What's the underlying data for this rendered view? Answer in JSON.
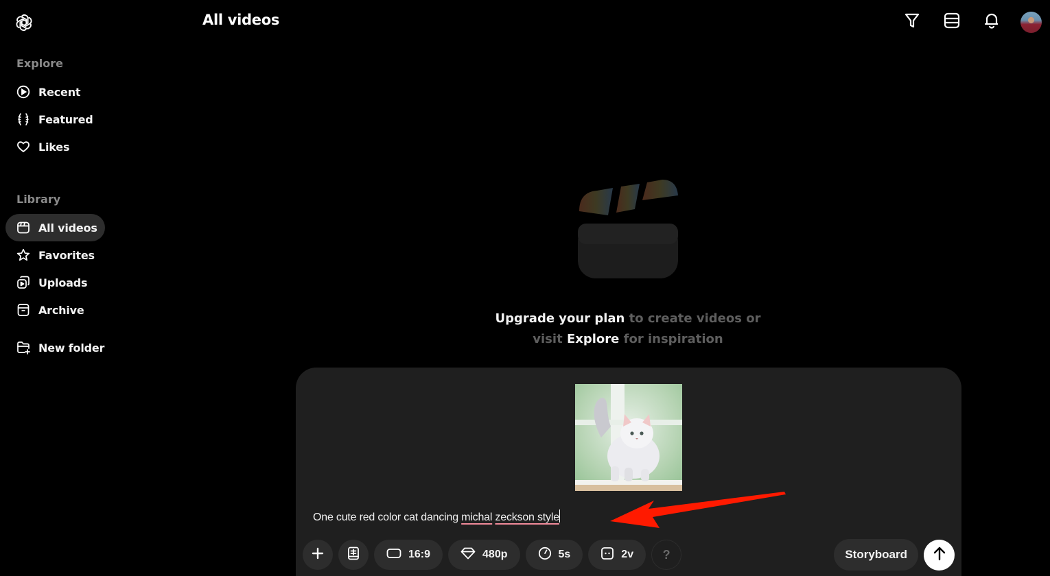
{
  "header": {
    "title": "All videos",
    "logo_icon": "openai-logo-icon",
    "actions": [
      {
        "name": "filter",
        "icon": "filter-icon"
      },
      {
        "name": "layout",
        "icon": "list-layout-icon"
      },
      {
        "name": "notifications",
        "icon": "bell-icon"
      },
      {
        "name": "profile",
        "icon": "avatar"
      }
    ]
  },
  "sidebar": {
    "explore_label": "Explore",
    "explore_items": [
      {
        "label": "Recent",
        "icon": "play-circle-icon"
      },
      {
        "label": "Featured",
        "icon": "laurel-icon"
      },
      {
        "label": "Likes",
        "icon": "heart-icon"
      }
    ],
    "library_label": "Library",
    "library_items": [
      {
        "label": "All videos",
        "icon": "clapperboard-icon",
        "active": true
      },
      {
        "label": "Favorites",
        "icon": "star-icon"
      },
      {
        "label": "Uploads",
        "icon": "uploads-icon"
      },
      {
        "label": "Archive",
        "icon": "archive-icon"
      }
    ],
    "new_folder_label": "New folder"
  },
  "empty_state": {
    "highlight_1": "Upgrade your plan",
    "text_1": " to create videos or",
    "text_2": "visit ",
    "highlight_2": "Explore",
    "text_3": " for inspiration"
  },
  "composer": {
    "attached_image": "cat-photo",
    "prompt_parts": {
      "plain": "One cute red color cat dancing ",
      "misspelled_1": "michal",
      "space": " ",
      "misspelled_2": "zeckson style"
    },
    "toolbar": {
      "add_icon": "plus-icon",
      "preset_icon": "preset-book-icon",
      "aspect_ratio": "16:9",
      "resolution": "480p",
      "duration": "5s",
      "variations": "2v",
      "help": "?"
    },
    "storyboard_label": "Storyboard",
    "send_icon": "arrow-up-icon"
  },
  "colors": {
    "background": "#000000",
    "panel": "#1f1f1f",
    "pill": "#2d2d2d",
    "muted_text": "#8a8a8a",
    "annotation_red": "#ff1a00",
    "spellcheck_underline": "#f28b9b"
  }
}
